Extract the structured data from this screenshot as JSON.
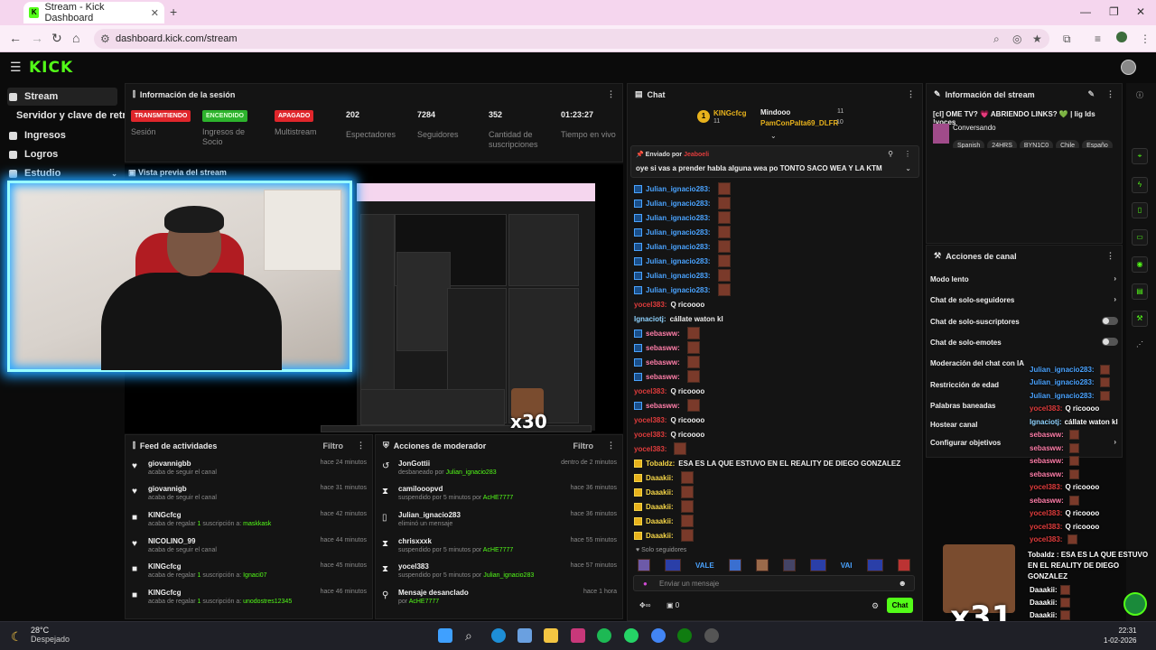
{
  "browser": {
    "tab_title": "Stream - Kick Dashboard",
    "url": "dashboard.kick.com/stream"
  },
  "app": {
    "logo": "KICK"
  },
  "sidebar": {
    "items": [
      {
        "label": "Stream",
        "active": true
      },
      {
        "label": "Servidor y clave de retransmisión"
      },
      {
        "label": "Ingresos"
      },
      {
        "label": "Logros"
      },
      {
        "label": "Estudio"
      }
    ]
  },
  "session": {
    "title": "Información de la sesión",
    "statuses": [
      {
        "badge": "TRANSMITIENDO",
        "label": "Sesión",
        "color": "#e0262b"
      },
      {
        "badge": "ENCENDIDO",
        "label": "Ingresos de Socio",
        "color": "#2db32d"
      },
      {
        "badge": "APAGADO",
        "label": "Multistream",
        "color": "#e0262b"
      }
    ],
    "stats": [
      {
        "value": "202",
        "label": "Espectadores"
      },
      {
        "value": "7284",
        "label": "Seguidores"
      },
      {
        "value": "352",
        "label": "Cantidad de suscripciones"
      },
      {
        "value": "01:23:27",
        "label": "Tiempo en vivo"
      }
    ]
  },
  "preview": {
    "title": "Vista previa del stream",
    "overlay_text": "x30"
  },
  "activity": {
    "title": "Feed de actividades",
    "filter": "Filtro",
    "rows": [
      {
        "name": "giovannigbb",
        "desc": "acaba de seguir el canal",
        "time": "hace 24 minutos",
        "icon": "heart"
      },
      {
        "name": "giovannigb",
        "desc": "acaba de seguir el canal",
        "time": "hace 31 minutos",
        "icon": "heart"
      },
      {
        "name": "KINGcfcg",
        "desc": "acaba de regalar",
        "count": "1",
        "desc2": "suscripción a:",
        "target": "maskkask",
        "time": "hace 42 minutos",
        "icon": "gift"
      },
      {
        "name": "NICOLINO_99",
        "desc": "acaba de seguir el canal",
        "time": "hace 44 minutos",
        "icon": "heart"
      },
      {
        "name": "KINGcfcg",
        "desc": "acaba de regalar",
        "count": "1",
        "desc2": "suscripción a:",
        "target": "Ignaci07",
        "time": "hace 45 minutos",
        "icon": "gift"
      },
      {
        "name": "KINGcfcg",
        "desc": "acaba de regalar",
        "count": "1",
        "desc2": "suscripción a:",
        "target": "unodostres12345",
        "time": "hace 46 minutos",
        "icon": "gift"
      }
    ]
  },
  "mod_actions": {
    "title": "Acciones de moderador",
    "filter": "Filtro",
    "rows": [
      {
        "name": "JonGottii",
        "desc": "desbaneado por",
        "by": "Julian_ignacio283",
        "time": "dentro de 2 minutos",
        "icon": "undo"
      },
      {
        "name": "camilooopvd",
        "desc": "suspendido por 5 minutos por",
        "by": "AcHE7777",
        "time": "hace 36 minutos",
        "icon": "hourglass"
      },
      {
        "name": "Julian_ignacio283",
        "desc": "eliminó un mensaje",
        "by": "",
        "time": "hace 36 minutos",
        "icon": "trash"
      },
      {
        "name": "chrisxxxk",
        "desc": "suspendido por 5 minutos por",
        "by": "AcHE7777",
        "time": "hace 55 minutos",
        "icon": "hourglass"
      },
      {
        "name": "yocel383",
        "desc": "suspendido por 5 minutos por",
        "by": "Julian_ignacio283",
        "time": "hace 57 minutos",
        "icon": "hourglass"
      },
      {
        "name": "Mensaje desanclado",
        "desc": "por",
        "by": "AcHE7777",
        "time": "hace 1 hora",
        "icon": "pin"
      }
    ]
  },
  "chat": {
    "title": "Chat",
    "gifters": [
      {
        "rank": "1",
        "name": "KINGcfcg",
        "count": "11"
      },
      {
        "name": "Mindooo",
        "count": "11"
      },
      {
        "name": "PamConPalta69_DLFR",
        "count": "10"
      }
    ],
    "pinned": {
      "by_label": "Enviado por",
      "by": "Jeaboeli",
      "text": "oye si vas a prender habla alguna wea po TONTO SACO WEA Y LA KTM"
    },
    "messages": [
      {
        "user": "Julian_ignacio283:",
        "text": "",
        "style": "blue"
      },
      {
        "user": "Julian_ignacio283:",
        "text": "",
        "style": "blue"
      },
      {
        "user": "Julian_ignacio283:",
        "text": "",
        "style": "blue"
      },
      {
        "user": "Julian_ignacio283:",
        "text": "",
        "style": "blue"
      },
      {
        "user": "Julian_ignacio283:",
        "text": "",
        "style": "blue"
      },
      {
        "user": "Julian_ignacio283:",
        "text": "",
        "style": "blue"
      },
      {
        "user": "Julian_ignacio283:",
        "text": "",
        "style": "blue"
      },
      {
        "user": "Julian_ignacio283:",
        "text": "",
        "style": "blue"
      },
      {
        "user": "yocel383:",
        "text": "Q ricoooo",
        "style": "red"
      },
      {
        "user": "Ignaciotj:",
        "text": "cállate waton kl",
        "style": "cyan"
      },
      {
        "user": "sebasww:",
        "text": "",
        "style": "pink"
      },
      {
        "user": "sebasww:",
        "text": "",
        "style": "pink"
      },
      {
        "user": "sebasww:",
        "text": "",
        "style": "pink"
      },
      {
        "user": "sebasww:",
        "text": "",
        "style": "pink"
      },
      {
        "user": "yocel383:",
        "text": "Q ricoooo",
        "style": "red"
      },
      {
        "user": "sebasww:",
        "text": "",
        "style": "pink"
      },
      {
        "user": "yocel383:",
        "text": "Q ricoooo",
        "style": "red"
      },
      {
        "user": "yocel383:",
        "text": "Q ricoooo",
        "style": "red"
      },
      {
        "user": "yocel383:",
        "text": "",
        "style": "red"
      },
      {
        "user": "Tobaldz:",
        "text": "ESA ES LA QUE ESTUVO EN EL REALITY DE DIEGO GONZALEZ",
        "style": "yellow"
      },
      {
        "user": "Daaakii:",
        "text": "",
        "style": "yellow"
      },
      {
        "user": "Daaakii:",
        "text": "",
        "style": "yellow"
      },
      {
        "user": "Daaakii:",
        "text": "",
        "style": "yellow"
      },
      {
        "user": "Daaakii:",
        "text": "",
        "style": "yellow"
      },
      {
        "user": "Daaakii:",
        "text": "",
        "style": "yellow"
      }
    ],
    "mode": "Solo seguidores",
    "emote_labels": [
      "VALE",
      "VAI"
    ],
    "input_placeholder": "Enviar un mensaje",
    "points": "0",
    "send_label": "Chat"
  },
  "stream_info": {
    "title": "Información del stream",
    "stream_title": "[cl] OME TV? 💗 ABRIENDO LINKS? 💚 | lig lds !voces",
    "category": "Conversando",
    "tags": [
      "Spanish",
      "24HRS",
      "BYN1C0",
      "Chile",
      "Españo"
    ]
  },
  "channel_actions": {
    "title": "Acciones de canal",
    "items": [
      {
        "label": "Modo lento",
        "control": "chevron"
      },
      {
        "label": "Chat de solo-seguidores",
        "control": "chevron"
      },
      {
        "label": "Chat de solo-suscriptores",
        "control": "toggle"
      },
      {
        "label": "Chat de solo-emotes",
        "control": "toggle"
      },
      {
        "label": "Moderación del chat con IA",
        "control": "none"
      },
      {
        "label": "Restricción de edad",
        "control": "none"
      },
      {
        "label": "Palabras baneadas",
        "control": "none"
      },
      {
        "label": "Hostear canal",
        "control": "none"
      },
      {
        "label": "Configurar objetivos",
        "control": "chevron"
      }
    ]
  },
  "overlay_chat": {
    "lines": [
      {
        "user": "Julian_ignacio283:",
        "text": "",
        "style": "blue"
      },
      {
        "user": "Julian_ignacio283:",
        "text": "",
        "style": "blue"
      },
      {
        "user": "Julian_ignacio283:",
        "text": "",
        "style": "blue"
      },
      {
        "user": "yocel383:",
        "text": "Q ricoooo",
        "style": "red"
      },
      {
        "user": "Ignaciotj:",
        "text": "cállate waton kl",
        "style": "cyan"
      },
      {
        "user": "sebasww:",
        "text": "",
        "style": "pink"
      },
      {
        "user": "sebasww:",
        "text": "",
        "style": "pink"
      },
      {
        "user": "sebasww:",
        "text": "",
        "style": "pink"
      },
      {
        "user": "sebasww:",
        "text": "",
        "style": "pink"
      },
      {
        "user": "yocel383:",
        "text": "Q ricoooo",
        "style": "red"
      },
      {
        "user": "sebasww:",
        "text": "",
        "style": "pink"
      },
      {
        "user": "yocel383:",
        "text": "Q ricoooo",
        "style": "red"
      },
      {
        "user": "yocel383:",
        "text": "Q ricoooo",
        "style": "red"
      },
      {
        "user": "yocel383:",
        "text": "",
        "style": "red"
      }
    ],
    "big_line": "Tobaldz : ESA ES LA QUE ESTUVO EN EL REALITY DE DIEGO GONZALEZ",
    "tail": [
      {
        "user": "Daaakii:"
      },
      {
        "user": "Daaakii:"
      },
      {
        "user": "Daaakii:"
      },
      {
        "user": "Daaakii:"
      },
      {
        "user": "Daaakii:"
      }
    ],
    "x31": "x31"
  },
  "taskbar": {
    "temp": "28°C",
    "weather": "Despejado",
    "time": "22:31",
    "date": "1-02-2026"
  }
}
